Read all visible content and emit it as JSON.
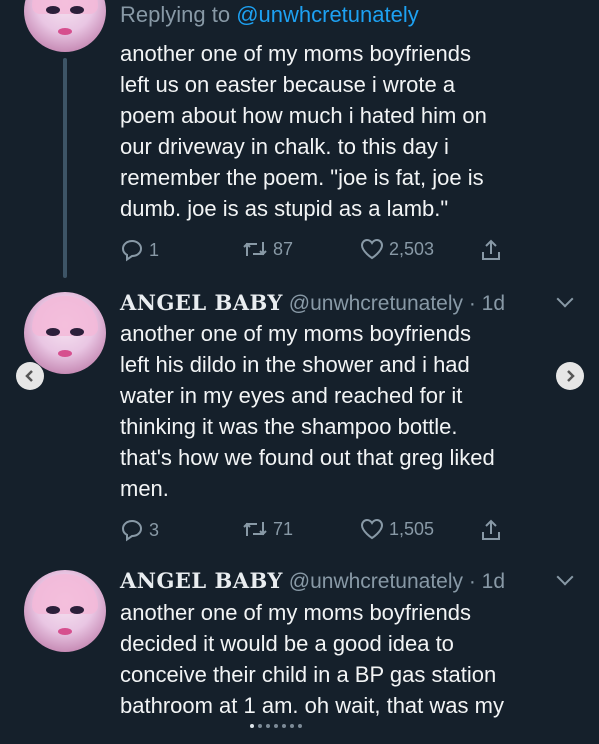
{
  "tweet1": {
    "reply_prefix": "Replying to ",
    "reply_mention": "@unwhcretunately",
    "lines": [
      "another one of my moms boyfriends",
      "left us on easter because i wrote a",
      "poem about how much i hated him on",
      "our driveway in chalk. to this day i",
      "remember the poem. \"joe is fat, joe is",
      "dumb. joe is as stupid as a lamb.\""
    ],
    "replies": "1",
    "retweets": "87",
    "likes": "2,503"
  },
  "tweet2": {
    "name": "ANGEL BABY",
    "handle": "@unwhcretunately",
    "time": "· 1d",
    "lines": [
      "another one of my moms boyfriends",
      "left his dildo in the shower and i had",
      "water in my eyes and reached for it",
      "thinking it was the shampoo bottle.",
      "that's how we found out that greg liked",
      "men."
    ],
    "replies": "3",
    "retweets": "71",
    "likes": "1,505"
  },
  "tweet3": {
    "name": "ANGEL BABY",
    "handle": "@unwhcretunately",
    "time": "· 1d",
    "lines": [
      "another one of my moms boyfriends",
      "decided it would be a good idea to",
      "conceive their child in a BP gas station",
      "bathroom at 1 am. oh wait, that was my"
    ]
  },
  "icons": [
    "reply-icon",
    "retweet-icon",
    "like-icon",
    "share-icon",
    "chevron-down-icon",
    "chevron-left-icon",
    "chevron-right-icon"
  ],
  "colors": {
    "background": "#15202b",
    "link": "#1da1f2",
    "muted": "#8899a6",
    "text": "#f2f4f5"
  }
}
